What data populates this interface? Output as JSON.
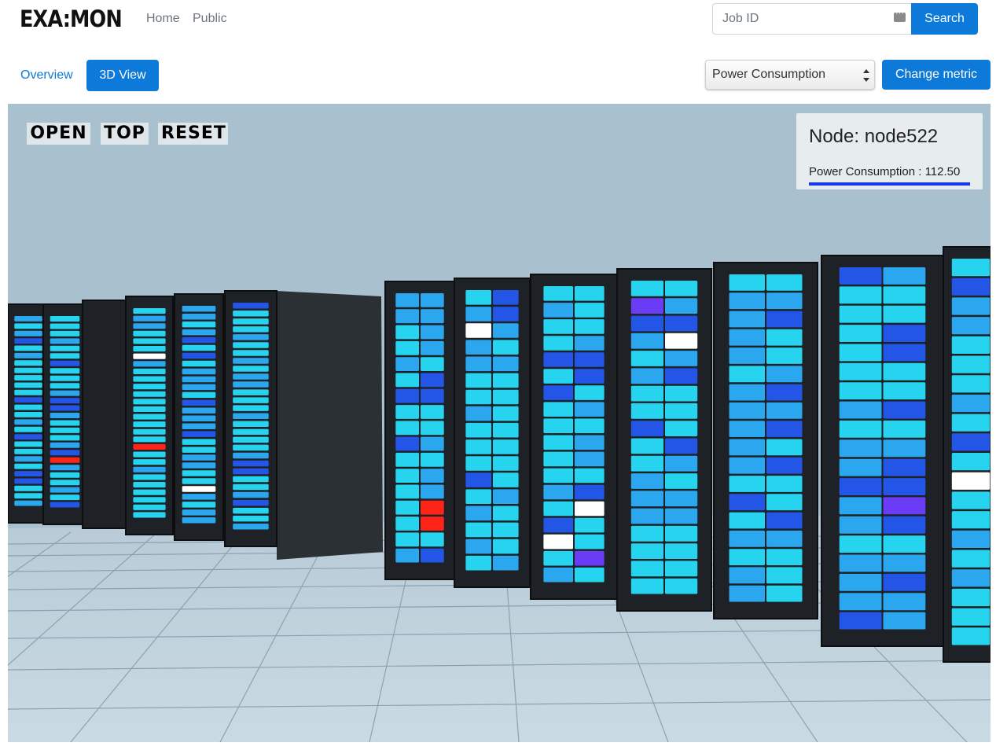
{
  "header": {
    "logo": "EXA:MON",
    "nav": [
      {
        "label": "Home"
      },
      {
        "label": "Public"
      }
    ],
    "search": {
      "placeholder": "Job ID",
      "value": "",
      "button_label": "Search"
    }
  },
  "toolbar": {
    "tabs": [
      {
        "label": "Overview",
        "active": false
      },
      {
        "label": "3D View",
        "active": true
      }
    ],
    "metric_select": {
      "selected": "Power Consumption"
    },
    "change_metric_label": "Change metric"
  },
  "scene": {
    "controls": [
      {
        "label": "OPEN"
      },
      {
        "label": "TOP"
      },
      {
        "label": "RESET"
      }
    ],
    "info": {
      "title": "Node: node522",
      "metric_label": "Power Consumption : 112.50",
      "value": 112.5
    },
    "colors": {
      "background": "#a9c0cf",
      "floor": "#bfd2dc",
      "rack": "#1e2226",
      "node_normal": "#27d4f0",
      "node_medium": "#2aa7ef",
      "node_high": "#2356e6",
      "node_purple": "#6a3cf5",
      "node_alert": "#ff2418",
      "node_idle": "#ffffff",
      "accent": "#0d79d8"
    }
  }
}
